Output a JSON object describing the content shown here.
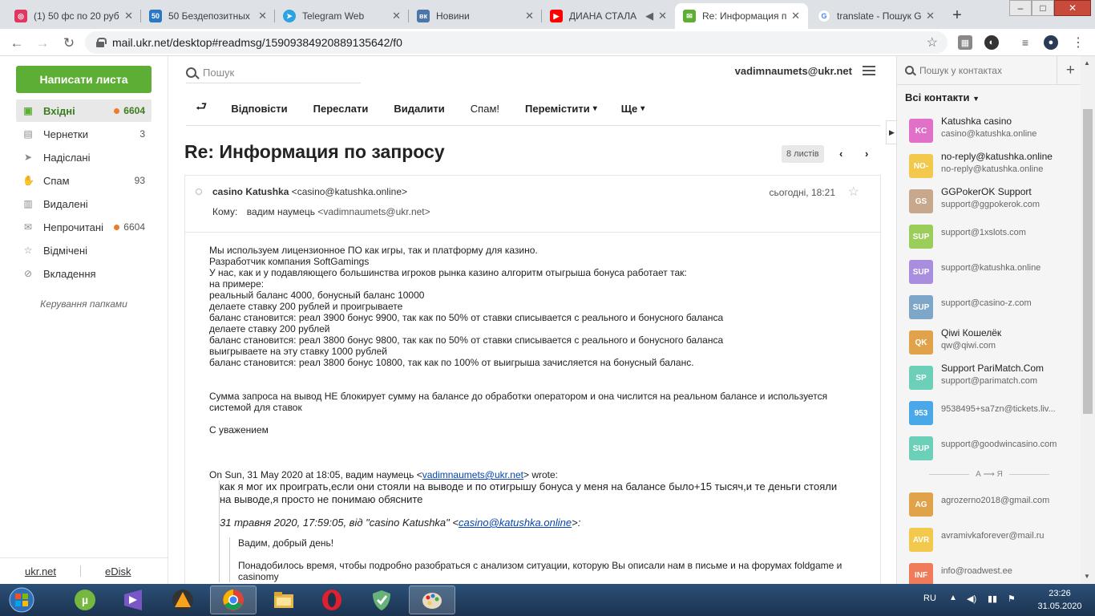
{
  "browser": {
    "tabs": [
      {
        "title": "(1) 50 фс по 20 руб",
        "favicon_color": "#e0365f",
        "active": false
      },
      {
        "title": "50 Бездепозитных",
        "favicon_color": "#2b78c2",
        "active": false
      },
      {
        "title": "Telegram Web",
        "favicon_color": "#2aa3e0",
        "active": false
      },
      {
        "title": "Новини",
        "favicon_color": "#4a76a8",
        "active": false
      },
      {
        "title": "ДИАНА СТАЛА",
        "favicon_color": "#ff0000",
        "active": false
      },
      {
        "title": "Re: Информация п",
        "favicon_color": "#5cae35",
        "active": true
      },
      {
        "title": "translate - Пошук G",
        "favicon_color": "#4285f4",
        "active": false
      }
    ],
    "url": "mail.ukr.net/desktop#readmsg/15909384920889135642/f0",
    "window_controls": [
      "–",
      "□",
      "✕"
    ]
  },
  "sidebar": {
    "compose_label": "Написати листа",
    "folders": [
      {
        "name": "Вхідні",
        "count": "6604",
        "icon": "inbox-icon",
        "glyph": "▣",
        "dot": true,
        "active": true
      },
      {
        "name": "Чернетки",
        "count": "3",
        "icon": "drafts-icon",
        "glyph": "▤",
        "dot": false,
        "active": false
      },
      {
        "name": "Надіслані",
        "count": "",
        "icon": "sent-icon",
        "glyph": "➤",
        "dot": false,
        "active": false
      },
      {
        "name": "Спам",
        "count": "93",
        "icon": "spam-icon",
        "glyph": "✋",
        "dot": false,
        "active": false
      },
      {
        "name": "Видалені",
        "count": "",
        "icon": "trash-icon",
        "glyph": "🗑",
        "dot": false,
        "active": false
      },
      {
        "name": "Непрочитані",
        "count": "6604",
        "icon": "unread-icon",
        "glyph": "✉",
        "dot": true,
        "active": false
      },
      {
        "name": "Відмічені",
        "count": "",
        "icon": "star-icon",
        "glyph": "☆",
        "dot": false,
        "active": false
      },
      {
        "name": "Вкладення",
        "count": "",
        "icon": "attachment-icon",
        "glyph": "🔗",
        "dot": false,
        "active": false
      }
    ],
    "manage_label": "Керування папками",
    "footer": {
      "left": "ukr.net",
      "right": "eDisk"
    }
  },
  "header": {
    "search_placeholder": "Пошук",
    "user_email": "vadimnaumets@ukr.net"
  },
  "actions": {
    "back_glyph": "⮐",
    "reply": "Відповісти",
    "forward": "Переслати",
    "delete": "Видалити",
    "spam": "Спам!",
    "move": "Перемістити",
    "more": "Ще",
    "caret": "▾"
  },
  "message": {
    "subject": "Re: Информация по запросу",
    "thread_count": "8 листів",
    "prev": "‹",
    "next": "›",
    "from_name": "casino Katushka",
    "from_addr": "<casino@katushka.online>",
    "to_label": "Кому:",
    "to_name": "вадим наумець",
    "to_addr": "<vadimnaumets@ukr.net>",
    "time": "сьогодні, 18:21",
    "body_lines": [
      "Мы используем лицензионное ПО как игры, так и платформу для казино.",
      "Разработчик компания SoftGamings",
      "У нас, как и у подавляющего большинства игроков рынка казино  алгоритм отыгрыша бонуса работает так:",
      "на примере:",
      "реальный баланс 4000, бонусный баланс 10000",
      "делаете ставку 200 рублей и проигрываете",
      "баланс становится: реал 3900 бонус 9900, так как по 50% от ставки списывается с реального и бонусного баланса",
      "делаете ставку 200 рублей",
      "баланс становится: реал 3800 бонус 9800, так как по 50% от ставки списывается с реального и бонусного баланса",
      "выигрываете на эту ставку 1000 рублей",
      "баланс становится: реал 3800 бонус 10800, так как по 100% от выигрыша зачисляется на бонусный баланс."
    ],
    "body_lines_2": [
      "Сумма запроса на вывод НЕ блокирует сумму на балансе до обработки оператором и она числится на реальном балансе и используется",
      "системой для ставок"
    ],
    "signoff": "С уважением",
    "quote_header_pre": "On Sun, 31 May 2020 at 18:05, вадим наумець <",
    "quote_header_link": "vadimnaumets@ukr.net",
    "quote_header_post": "> wrote:",
    "quote_line_1": "как я мог их проиграть,если они стояли на выводе и по отигрышу бонуса у меня на балансе было+15 тысяч,и те деньги стояли",
    "quote_line_2": "на выводе,я просто не понимаю обясните",
    "inner_quote_pre": "31 травня 2020, 17:59:05, від \"casino Katushka\" <",
    "inner_quote_link": "casino@katushka.online",
    "inner_quote_post": ">:",
    "inner_greeting": "Вадим, добрый день!",
    "inner_line_1": "Понадобилось время, чтобы подробно разобраться с анализом ситуации, которую Вы описали нам в письме и на форумах foldgame и",
    "inner_line_2": "casinomy"
  },
  "contacts": {
    "search_placeholder": "Пошук у контактах",
    "add_glyph": "+",
    "all_label": "Всі контакти",
    "items": [
      {
        "initials": "KC",
        "color": "#e070c8",
        "name": "Katushka casino",
        "email": "casino@katushka.online"
      },
      {
        "initials": "NO-",
        "color": "#f2c94c",
        "name": "no-reply@katushka.online",
        "email": "no-reply@katushka.online"
      },
      {
        "initials": "GS",
        "color": "#c8a88c",
        "name": "GGPokerOK Support",
        "email": "support@ggpokerok.com"
      },
      {
        "initials": "SUP",
        "color": "#9bcd5a",
        "name": "",
        "email": "support@1xslots.com"
      },
      {
        "initials": "SUP",
        "color": "#a98ee0",
        "name": "",
        "email": "support@katushka.online"
      },
      {
        "initials": "SUP",
        "color": "#7ea6c8",
        "name": "",
        "email": "support@casino-z.com"
      },
      {
        "initials": "QK",
        "color": "#e0a34a",
        "name": "Qiwi Кошелёк",
        "email": "qw@qiwi.com"
      },
      {
        "initials": "SP",
        "color": "#6ccfb8",
        "name": "Support PariMatch.Com",
        "email": "support@parimatch.com"
      },
      {
        "initials": "953",
        "color": "#4aa8e8",
        "name": "",
        "email": "9538495+sa7zn@tickets.liv..."
      },
      {
        "initials": "SUP",
        "color": "#6ccfb8",
        "name": "",
        "email": "support@goodwincasino.com"
      }
    ],
    "az_label": "А ⟶ Я",
    "items_2": [
      {
        "initials": "AG",
        "color": "#e0a34a",
        "name": "",
        "email": "agrozerno2018@gmail.com"
      },
      {
        "initials": "AVR",
        "color": "#f2c94c",
        "name": "",
        "email": "avramivkaforever@mail.ru"
      },
      {
        "initials": "INF",
        "color": "#f07b5a",
        "name": "",
        "email": "info@roadwest.ee"
      }
    ]
  },
  "taskbar": {
    "lang": "RU",
    "time": "23:26",
    "date": "31.05.2020"
  }
}
